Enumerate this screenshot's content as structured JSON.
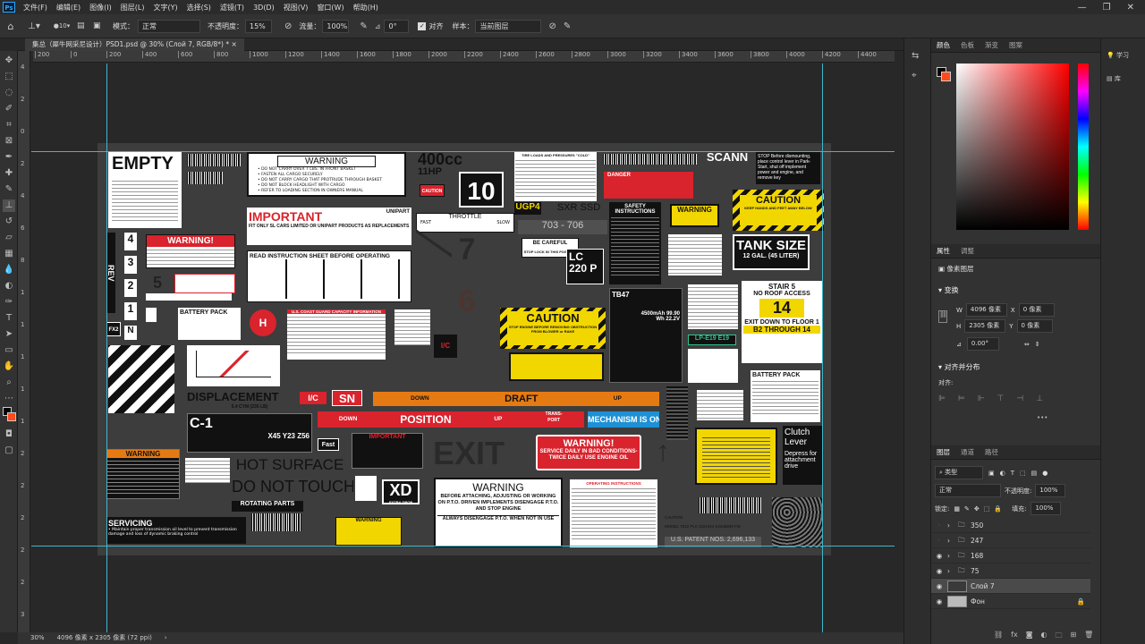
{
  "menubar": {
    "logo": "Ps",
    "items": [
      "文件(F)",
      "编辑(E)",
      "图像(I)",
      "图层(L)",
      "文字(Y)",
      "选择(S)",
      "滤镜(T)",
      "3D(D)",
      "视图(V)",
      "窗口(W)",
      "帮助(H)"
    ],
    "window_controls": [
      "—",
      "❐",
      "✕"
    ]
  },
  "options": {
    "brush_size": "10",
    "mode_label": "模式：",
    "mode_value": "正常",
    "opacity_label": "不透明度：",
    "opacity_value": "15%",
    "flow_label": "流量：",
    "flow_value": "100%",
    "angle_label": "⊿",
    "angle_value": "0°",
    "align_label": "对齐",
    "sample_label": "样本：",
    "sample_value": "当前图层"
  },
  "document": {
    "tab_title": "集总（犀牛网采尼设计）PSD1.psd @ 30% (Слой 7, RGB/8*) *",
    "status_zoom": "30%",
    "status_size": "4096 像素 x 2305 像素 (72 ppi)"
  },
  "rulers": {
    "top": [
      "200",
      "0",
      "200",
      "400",
      "600",
      "800",
      "1000",
      "1200",
      "1400",
      "1600",
      "1800",
      "2000",
      "2200",
      "2400",
      "2600",
      "2800",
      "3000",
      "3200",
      "3400",
      "3600",
      "3800",
      "4000",
      "4200",
      "4400"
    ],
    "left": [
      "4",
      "2",
      "0",
      "2",
      "4",
      "6",
      "8",
      "1",
      "1",
      "1",
      "1",
      "1",
      "2",
      "2",
      "2",
      "2",
      "2",
      "3"
    ]
  },
  "labels": {
    "empty": "EMPTY",
    "warning1": "WARNING",
    "warning1_lines": [
      "• DO NOT CARRY OVER 7 LBS. IN FRONT BASKET",
      "• FASTEN ALL CARGO SECURELY",
      "• DO NOT CARRY CARGO THAT PROTRUDE THROUGH BASKET",
      "• DO NOT BLOCK HEADLIGHT WITH CARGO",
      "• REFER TO LOADING SECTION IN OWNERS MANUAL"
    ],
    "cc400": "400cc",
    "hp11": "11HP",
    "ten": "10",
    "caution_small": "CAUTION",
    "tire_title": "TIRE LOADS AND PRESSURES \"COLD\"",
    "danger": "DANGER",
    "scann": "SCANN",
    "stop_text": "STOP Before dismounting, place control lever in Park-Start, shut off implement power and engine, and remove key",
    "important": "IMPORTANT",
    "unipart": "UNIPART",
    "important_text": "FIT ONLY SL CARS LIMITED OR UNIPART PRODUCTS AS REPLACEMENTS",
    "throttle": "THROTTLE",
    "fast": "FAST",
    "slow": "SLOW",
    "ugp4": "UGP4",
    "sxr_ssd": "SXR SSD",
    "range": "703 - 706",
    "safety_instructions": "SAFETY INSTRUCTIONS",
    "warning_yellow": "WARNING",
    "caution_hz": "CAUTION",
    "caution_hz_sub": "KEEP HANDS AND FEET AWAY BELOW",
    "warning_red": "WARNING!",
    "read_sheet": "READ INSTRUCTION SHEET BEFORE OPERATING",
    "seven": "7",
    "six": "6",
    "be_careful": "BE CAREFUL",
    "stop_lock": "STOP LOCK IN THIS POSITION",
    "lc220": "LC 220 P",
    "tank_size": "TANK SIZE",
    "tank_sub": "12 GAL. (45 LITER)",
    "stair": "STAIR 5",
    "no_roof": "NO ROOF ACCESS",
    "fourteen": "14",
    "exit_down": "EXIT DOWN TO FLOOR 1",
    "through": "B2 THROUGH 14",
    "tb47": "TB47",
    "battery_spec": "4500mAh 99.90 Wh 22.2V",
    "lp_code": "LP-E19 E19",
    "caution_big": "CAUTION",
    "caution_big_sub": "STOP ENGINE BEFORE REMOVING OBSTRUCTION FROM BLOWER or RAKE",
    "battery_pack": "BATTERY PACK",
    "fx2": "FX2",
    "rev": "REV",
    "n_gear": "N",
    "gears": [
      "4",
      "3",
      "2",
      "1"
    ],
    "five": "5",
    "coast_guard": "U.S. COAST GUARD CAPACITY INFORMATION",
    "h_mark": "H",
    "ic": "I/C",
    "sn": "SN",
    "i_c2": "I/C",
    "displacement": "DISPLACEMENT",
    "displacement_sub": "5.4 CYM (235 LB)",
    "down": "DOWN",
    "draft": "DRAFT",
    "up": "UP",
    "position": "POSITION",
    "transport": "TRANS-PORT",
    "mechanism": "MECHANISM IS ON",
    "c1": "C-1",
    "c1_code": "X45 Y23 Z56",
    "warning_orange": "WARNING",
    "hot_surface": "HOT SURFACE",
    "do_not_touch": "DO NOT TOUCH",
    "rotating": "ROTATING PARTS",
    "fast2": "Fast",
    "important2": "IMPORTANT",
    "exit": "EXIT",
    "warning_service": "WARNING!",
    "warning_service_sub": "SERVICE DAILY IN BAD CONDITIONS- TWICE DAILY USE ENGINE OIL",
    "xd": "XD",
    "xd_sub": "EXTRA DROP",
    "warning_big": "WARNING",
    "warning_big_sub": "BEFORE ATTACHING, ADJUSTING OR WORKING ON P.T.O. DRIVEN IMPLEMENTS DISENGAGE P.T.O. AND STOP ENGINE",
    "always": "ALWAYS DISENGAGE P.T.O. WHEN NOT IN USE",
    "operating_instructions": "OPERATING INSTRUCTIONS",
    "servicing": "SERVICING",
    "servicing_sub": "• Maintain proper transmission oil level to prevent transmission damage and loss of dynamic braking control",
    "clutch": "Clutch Lever",
    "depress": "Depress for attachment drive",
    "battery_pack2": "BATTERY PACK",
    "patent": "U.S. PATENT NOS. 2,696,133",
    "warning_yellow2": "WARNING",
    "model_line": "MODEL 7512 PLC S/24444 S2446849 FM",
    "caution_small2": "CAUTION"
  },
  "right_panel": {
    "color_tabs": [
      "颜色",
      "色板",
      "渐变",
      "图案"
    ],
    "props_tabs": [
      "属性",
      "调整"
    ],
    "pixel_layer": "像素图层",
    "transform": "变换",
    "w_label": "W",
    "w_value": "4096 像素",
    "x_label": "X",
    "x_value": "0 像素",
    "h_label": "H",
    "h_value": "2305 像素",
    "y_label": "Y",
    "y_value": "0 像素",
    "angle_value": "0.00°",
    "align_section": "对齐并分布",
    "align_label": "对齐:",
    "more": "•••",
    "layers_tabs": [
      "图层",
      "通道",
      "路径"
    ],
    "kind_label": "类型",
    "blend_mode": "正常",
    "opacity_label": "不透明度:",
    "opacity_value": "100%",
    "lock_label": "锁定:",
    "fill_label": "填充:",
    "fill_value": "100%",
    "layers": [
      {
        "name": "350",
        "type": "group",
        "visible": false
      },
      {
        "name": "247",
        "type": "group",
        "visible": false
      },
      {
        "name": "168",
        "type": "group",
        "visible": true
      },
      {
        "name": "75",
        "type": "group",
        "visible": true
      },
      {
        "name": "Слой 7",
        "type": "layer",
        "visible": true
      },
      {
        "name": "Фон",
        "type": "background",
        "visible": true
      }
    ]
  },
  "far_panel": {
    "learn": "学习",
    "libraries": "库"
  },
  "colors": {
    "foreground": "#000000",
    "background": "#ff4a1c",
    "accent_guide": "#3fb6c9"
  }
}
